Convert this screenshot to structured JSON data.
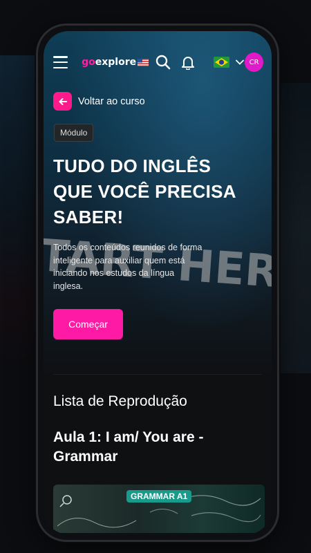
{
  "header": {
    "logo_prefix": "go",
    "logo_suffix": "explore",
    "avatar_initials": "CR"
  },
  "back": {
    "label": "Voltar ao curso"
  },
  "badge": {
    "label": "Módulo"
  },
  "hero": {
    "title": "TUDO DO INGLÊS QUE VOCÊ PRECISA SABER!",
    "description": "Todos os conteúdos reunidos de forma inteligente para auxiliar quem está iniciando nos estudos da língua inglesa.",
    "image_text": "START HERE",
    "start_button": "Começar"
  },
  "playlist": {
    "title": "Lista de Reprodução",
    "lesson_title": "Aula 1: I am/ You are - Grammar",
    "thumb_tag": "GRAMMAR A1"
  },
  "colors": {
    "accent": "#ff1aa5",
    "background": "#0f1012"
  }
}
